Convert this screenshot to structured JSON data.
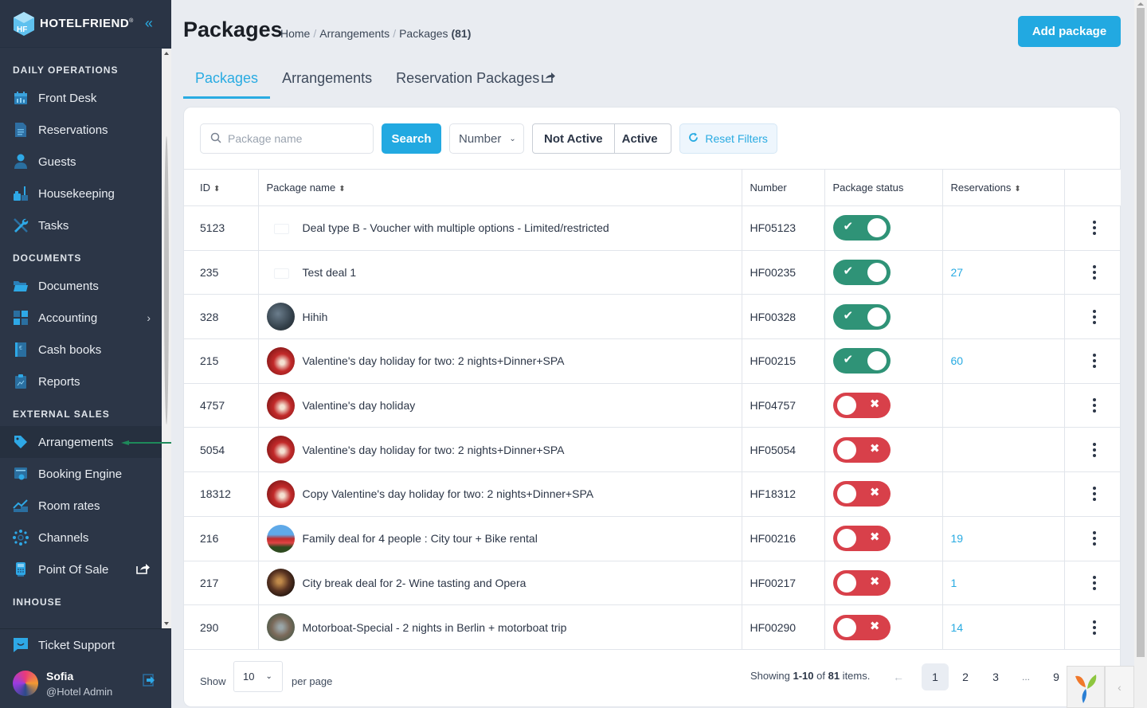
{
  "brand": {
    "name": "HOTELFRIEND",
    "mark": "®"
  },
  "sidebar": {
    "sections": [
      {
        "title": "DAILY OPERATIONS",
        "items": [
          {
            "label": "Front Desk",
            "icon": "calendar-icon"
          },
          {
            "label": "Reservations",
            "icon": "document-icon"
          },
          {
            "label": "Guests",
            "icon": "user-icon"
          },
          {
            "label": "Housekeeping",
            "icon": "broom-icon"
          },
          {
            "label": "Tasks",
            "icon": "tools-icon"
          }
        ]
      },
      {
        "title": "DOCUMENTS",
        "items": [
          {
            "label": "Documents",
            "icon": "folder-icon"
          },
          {
            "label": "Accounting",
            "icon": "calculator-icon",
            "has_submenu": true
          },
          {
            "label": "Cash books",
            "icon": "cash-book-icon"
          },
          {
            "label": "Reports",
            "icon": "clipboard-chart-icon"
          }
        ]
      },
      {
        "title": "EXTERNAL SALES",
        "items": [
          {
            "label": "Arrangements",
            "icon": "tag-icon",
            "active": true
          },
          {
            "label": "Booking Engine",
            "icon": "booking-engine-icon"
          },
          {
            "label": "Room rates",
            "icon": "chart-up-icon"
          },
          {
            "label": "Channels",
            "icon": "network-icon"
          },
          {
            "label": "Point Of Sale",
            "icon": "pos-terminal-icon",
            "external": true
          }
        ]
      },
      {
        "title": "INHOUSE",
        "items": []
      }
    ],
    "ticket_support": "Ticket Support",
    "user": {
      "name": "Sofia",
      "role": "@Hotel Admin"
    }
  },
  "header": {
    "title": "Packages",
    "breadcrumb": [
      "Home",
      "Arrangements",
      "Packages"
    ],
    "count": "(81)",
    "add_button": "Add package"
  },
  "tabs": [
    {
      "label": "Packages",
      "active": true
    },
    {
      "label": "Arrangements"
    },
    {
      "label": "Reservation Packages",
      "external": true
    }
  ],
  "filters": {
    "search_placeholder": "Package name",
    "search_value": "",
    "search_button": "Search",
    "number_select": "Number",
    "status_not_active": "Not Active",
    "status_active": "Active",
    "reset": "Reset Filters"
  },
  "table": {
    "columns": [
      "ID",
      "Package name",
      "Number",
      "Package status",
      "Reservations",
      ""
    ],
    "rows": [
      {
        "id": "5123",
        "name": "Deal type B - Voucher with multiple options - Limited/restricted",
        "number": "HF05123",
        "active": true,
        "reservations": "",
        "thumb": "blank"
      },
      {
        "id": "235",
        "name": "Test deal 1",
        "number": "HF00235",
        "active": true,
        "reservations": "27",
        "thumb": "blank"
      },
      {
        "id": "328",
        "name": "Hihih",
        "number": "HF00328",
        "active": true,
        "reservations": "",
        "thumb": "room"
      },
      {
        "id": "215",
        "name": "Valentine's day holiday for two: 2 nights+Dinner+SPA",
        "number": "HF00215",
        "active": true,
        "reservations": "60",
        "thumb": "val"
      },
      {
        "id": "4757",
        "name": "Valentine's day holiday",
        "number": "HF04757",
        "active": false,
        "reservations": "",
        "thumb": "val"
      },
      {
        "id": "5054",
        "name": "Valentine's day holiday for two: 2 nights+Dinner+SPA",
        "number": "HF05054",
        "active": false,
        "reservations": "",
        "thumb": "val"
      },
      {
        "id": "18312",
        "name": "Copy Valentine's day holiday for two: 2 nights+Dinner+SPA",
        "number": "HF18312",
        "active": false,
        "reservations": "",
        "thumb": "val"
      },
      {
        "id": "216",
        "name": "Family deal for 4 people : City tour + Bike rental",
        "number": "HF00216",
        "active": false,
        "reservations": "19",
        "thumb": "bus"
      },
      {
        "id": "217",
        "name": "City break deal for 2- Wine tasting and Opera",
        "number": "HF00217",
        "active": false,
        "reservations": "1",
        "thumb": "wine"
      },
      {
        "id": "290",
        "name": "Motorboat-Special - 2 nights in Berlin + motorboat trip",
        "number": "HF00290",
        "active": false,
        "reservations": "14",
        "thumb": "boat"
      }
    ]
  },
  "footer": {
    "show": "Show",
    "per_page_value": "10",
    "per_page": "per page",
    "showing_prefix": "Showing ",
    "showing_range": "1-10",
    "showing_of": " of ",
    "showing_total": "81",
    "showing_suffix": " items.",
    "pages": [
      "1",
      "2",
      "3",
      "...",
      "9"
    ],
    "current_page": "1"
  },
  "colors": {
    "accent": "#22a9e1",
    "active_toggle": "#2f9377",
    "inactive_toggle": "#d8404a",
    "sidebar_bg": "#2c3647"
  }
}
